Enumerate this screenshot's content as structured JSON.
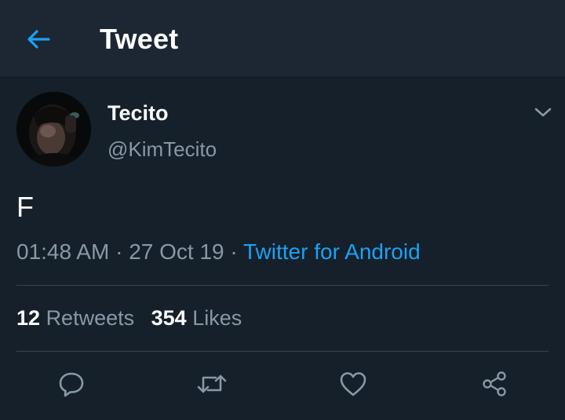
{
  "header": {
    "title": "Tweet",
    "back_icon": "arrow-left-icon"
  },
  "author": {
    "display_name": "Tecito",
    "handle": "@KimTecito"
  },
  "tweet": {
    "text": "F",
    "time": "01:48 AM",
    "date": "27 Oct 19",
    "source": "Twitter for Android",
    "separator": "·"
  },
  "stats": {
    "retweets_count": "12",
    "retweets_label": "Retweets",
    "likes_count": "354",
    "likes_label": "Likes"
  },
  "actions": [
    {
      "name": "reply",
      "icon": "reply-bubble-icon"
    },
    {
      "name": "retweet",
      "icon": "retweet-icon"
    },
    {
      "name": "like",
      "icon": "heart-icon"
    },
    {
      "name": "share",
      "icon": "share-icon"
    }
  ],
  "colors": {
    "background": "#15202b",
    "header": "#1c2733",
    "accent": "#1da1f2",
    "secondary_text": "#8899a6",
    "divider": "#38444d"
  }
}
